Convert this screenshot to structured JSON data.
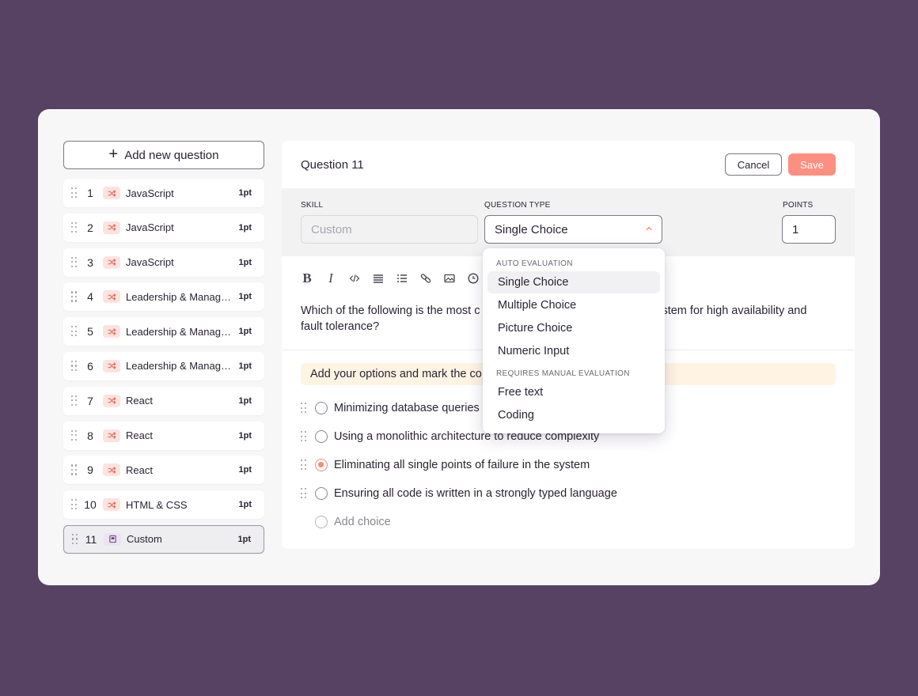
{
  "sidebar": {
    "add_label": "Add new question",
    "items": [
      {
        "num": "1",
        "skill": "JavaScript",
        "points": "1pt"
      },
      {
        "num": "2",
        "skill": "JavaScript",
        "points": "1pt"
      },
      {
        "num": "3",
        "skill": "JavaScript",
        "points": "1pt"
      },
      {
        "num": "4",
        "skill": "Leadership & Management",
        "points": "1pt"
      },
      {
        "num": "5",
        "skill": "Leadership & Management",
        "points": "1pt"
      },
      {
        "num": "6",
        "skill": "Leadership & Management",
        "points": "1pt"
      },
      {
        "num": "7",
        "skill": "React",
        "points": "1pt"
      },
      {
        "num": "8",
        "skill": "React",
        "points": "1pt"
      },
      {
        "num": "9",
        "skill": "React",
        "points": "1pt"
      },
      {
        "num": "10",
        "skill": "HTML & CSS",
        "points": "1pt"
      },
      {
        "num": "11",
        "skill": "Custom",
        "points": "1pt"
      }
    ]
  },
  "editor": {
    "title": "Question 11",
    "cancel_label": "Cancel",
    "save_label": "Save",
    "skill_label": "SKILL",
    "skill_placeholder": "Custom",
    "type_label": "QUESTION TYPE",
    "type_value": "Single Choice",
    "points_label": "POINTS",
    "points_value": "1",
    "question_part1": "Which of the following is the most c",
    "question_part2": "stem for high availability and",
    "question_part3": "fault tolerance?",
    "hint": "Add your options and mark the co",
    "options": [
      {
        "label": "Minimizing database queries",
        "selected": false
      },
      {
        "label": "Using a monolithic architecture to reduce complexity",
        "selected": false
      },
      {
        "label": "Eliminating all single points of failure in the system",
        "selected": true
      },
      {
        "label": "Ensuring all code is written in a strongly typed language",
        "selected": false
      }
    ],
    "add_choice": "Add choice"
  },
  "dropdown": {
    "group_auto": "AUTO EVALUATION",
    "auto_items": [
      "Single Choice",
      "Multiple Choice",
      "Picture Choice",
      "Numeric Input"
    ],
    "group_manual": "REQUIRES MANUAL EVALUATION",
    "manual_items": [
      "Free text",
      "Coding"
    ]
  },
  "colors": {
    "background": "#584263",
    "accent": "#fd8f80",
    "hint_bg": "#fff4e4"
  }
}
